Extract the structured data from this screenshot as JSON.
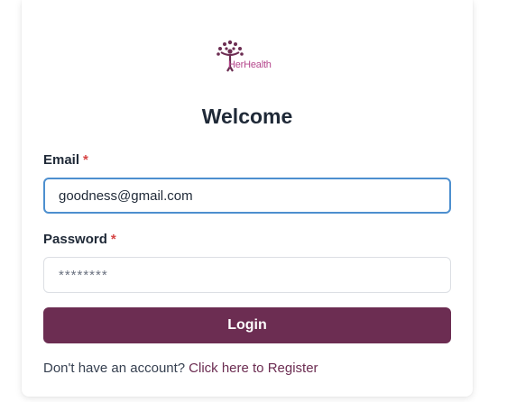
{
  "logo": {
    "text": "HerHealth",
    "icon": "tree-figure-icon",
    "color": "#6c2d52"
  },
  "form": {
    "title": "Welcome",
    "email_label": "Email",
    "email_value": "goodness@gmail.com",
    "password_label": "Password",
    "password_placeholder": "********",
    "required_marker": "*",
    "login_label": "Login"
  },
  "register": {
    "prompt": "Don't have an account?",
    "link_label": "Click here to Register"
  },
  "colors": {
    "brand": "#6c2d52",
    "logo_text": "#b5478c",
    "focus_border": "#4d8fcf",
    "required": "#d64545"
  }
}
